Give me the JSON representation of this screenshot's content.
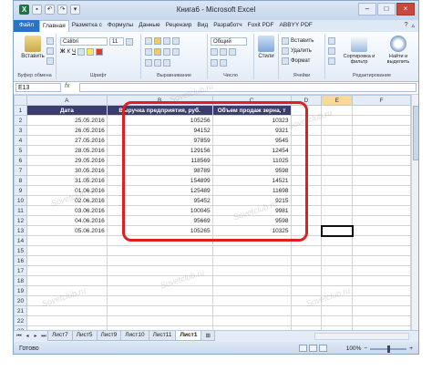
{
  "window": {
    "title": "Книга6 - Microsoft Excel",
    "logo_letter": "X",
    "quick_access": [
      "save-icon",
      "undo-icon",
      "redo-icon",
      "dropdown-icon"
    ],
    "controls": [
      "–",
      "□",
      "×"
    ]
  },
  "ribbon_tabs": [
    "Файл",
    "Главная",
    "Разметка с",
    "Формулы",
    "Данные",
    "Рецензир",
    "Вид",
    "Разработч",
    "Foxit PDF",
    "ABBYY PDF"
  ],
  "ribbon_tab_active": "Главная",
  "ribbon": {
    "clipboard": {
      "paste": "Вставить",
      "label": "Буфер обмена"
    },
    "font": {
      "name": "Calibri",
      "size": "11",
      "bold": "Ж",
      "italic": "К",
      "underline": "Ч",
      "label": "Шрифт"
    },
    "alignment": {
      "label": "Выравнивание"
    },
    "number": {
      "format": "Общий",
      "label": "Число"
    },
    "styles": {
      "button": "Стили"
    },
    "cells": {
      "insert": "Вставить",
      "delete": "Удалить",
      "format": "Формат",
      "label": "Ячейки"
    },
    "editing": {
      "sort": "Сортировка и фильтр",
      "find": "Найти и выделить",
      "label": "Редактирование"
    }
  },
  "formula_bar": {
    "name_box": "E13",
    "fx": "fx",
    "value": ""
  },
  "columns": [
    "A",
    "B",
    "C",
    "D",
    "E",
    "F"
  ],
  "headers": {
    "date": "Дата",
    "revenue": "Выручка предприятия, руб.",
    "grain": "Объем продаж зерна, т"
  },
  "rows": [
    {
      "date": "25.05.2016",
      "revenue": "105256",
      "grain": "10323"
    },
    {
      "date": "26.05.2016",
      "revenue": "94152",
      "grain": "9321"
    },
    {
      "date": "27.05.2016",
      "revenue": "97859",
      "grain": "9545"
    },
    {
      "date": "28.05.2016",
      "revenue": "129156",
      "grain": "12454"
    },
    {
      "date": "29.05.2016",
      "revenue": "118569",
      "grain": "11025"
    },
    {
      "date": "30.05.2016",
      "revenue": "98789",
      "grain": "9598"
    },
    {
      "date": "31.05.2016",
      "revenue": "154899",
      "grain": "14521"
    },
    {
      "date": "01.06.2016",
      "revenue": "125489",
      "grain": "11698"
    },
    {
      "date": "02.06.2016",
      "revenue": "95452",
      "grain": "9215"
    },
    {
      "date": "03.06.2016",
      "revenue": "100045",
      "grain": "9981"
    },
    {
      "date": "04.06.2016",
      "revenue": "95669",
      "grain": "9598"
    },
    {
      "date": "05.06.2016",
      "revenue": "105265",
      "grain": "10325"
    }
  ],
  "sheet_tabs": [
    "Лист7",
    "Лист5",
    "Лист9",
    "Лист10",
    "Лист11",
    "Лист1"
  ],
  "sheet_active": "Лист1",
  "status": {
    "ready": "Готово",
    "zoom": "100%"
  },
  "watermark": "Sovetclub.ru",
  "colors": {
    "header_fill": "#3b3d6c",
    "highlight_border": "#e02020",
    "file_tab": "#2a72c6"
  }
}
